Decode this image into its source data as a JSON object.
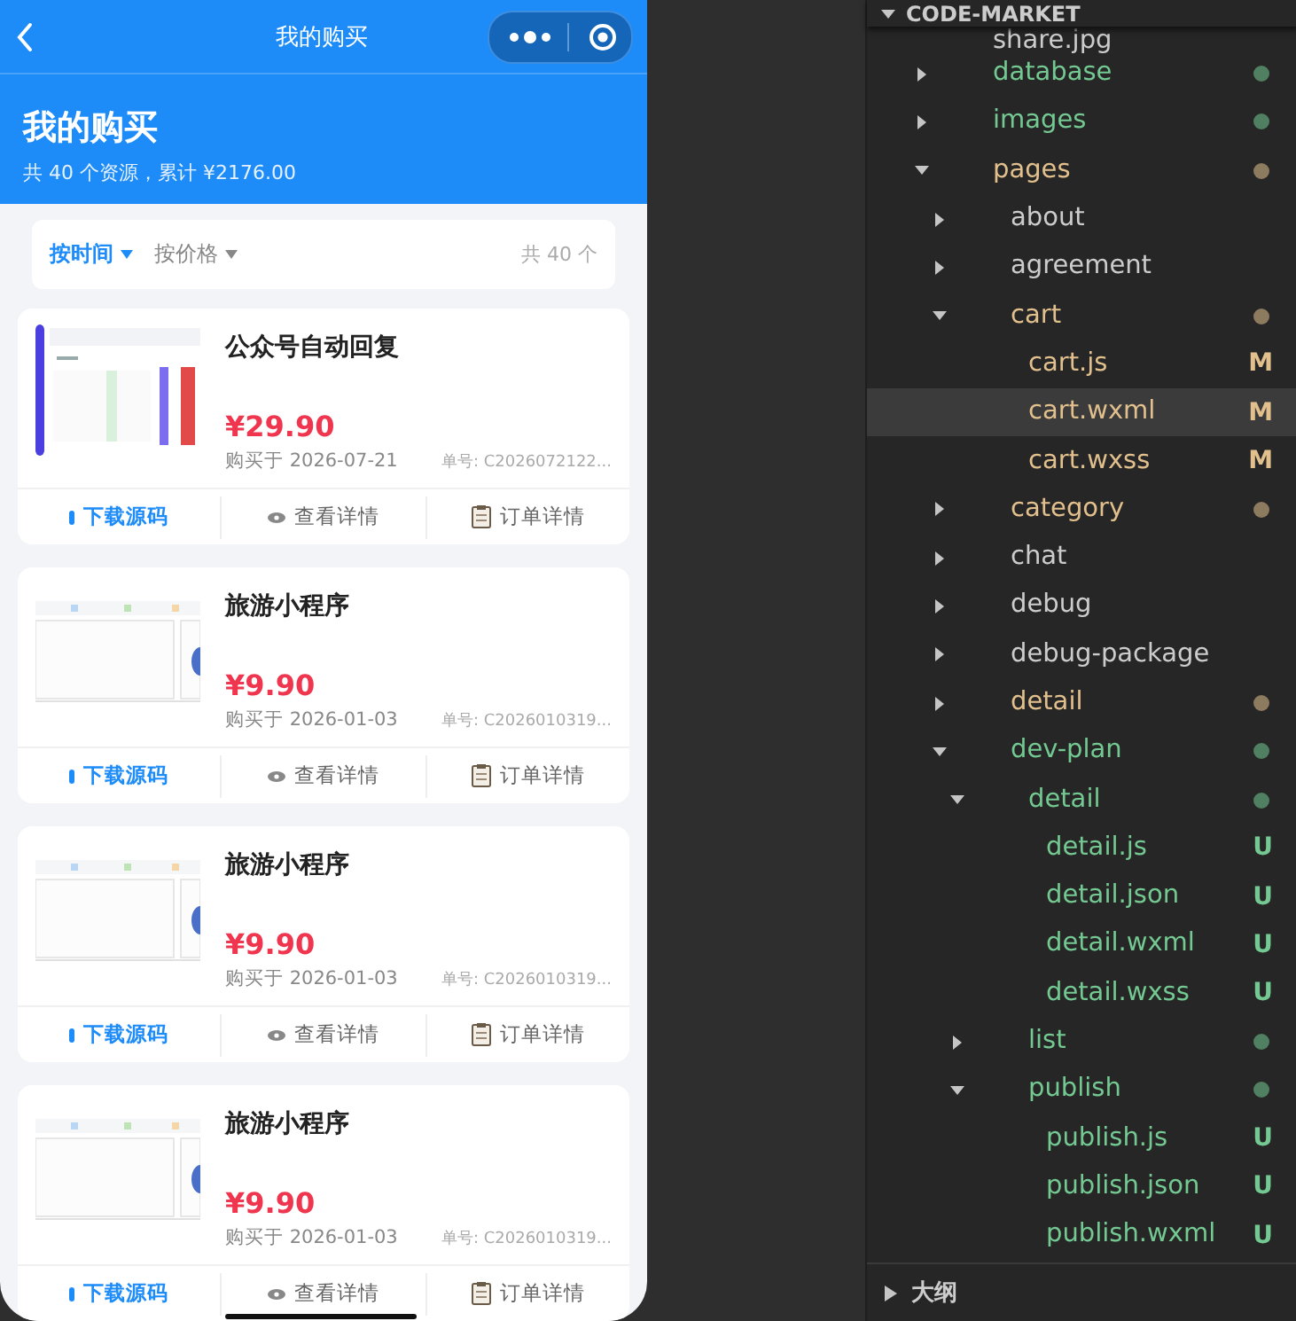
{
  "phone": {
    "nav": {
      "title": "我的购买"
    },
    "header": {
      "title": "我的购买",
      "subtitle": "共 40 个资源，累计 ¥2176.00"
    },
    "sort": [
      {
        "label": "按时间",
        "selected": true
      },
      {
        "label": "按价格",
        "selected": false
      }
    ],
    "count": "共 40 个",
    "orders": [
      {
        "title": "公众号自动回复",
        "price": "¥29.90",
        "date": "购买于 2026-07-21",
        "order_no": "单号: C2026072122...",
        "actions": [
          {
            "kind": "download",
            "label": "下载源码"
          },
          {
            "kind": "view",
            "label": "查看详情"
          },
          {
            "kind": "order",
            "label": "订单详情"
          }
        ]
      },
      {
        "title": "旅游小程序",
        "price": "¥9.90",
        "date": "购买于 2026-01-03",
        "order_no": "单号: C2026010319...",
        "actions": [
          {
            "kind": "download",
            "label": "下载源码"
          },
          {
            "kind": "view",
            "label": "查看详情"
          },
          {
            "kind": "order",
            "label": "订单详情"
          }
        ]
      },
      {
        "title": "旅游小程序",
        "price": "¥9.90",
        "date": "购买于 2026-01-03",
        "order_no": "单号: C2026010319...",
        "actions": [
          {
            "kind": "download",
            "label": "下载源码"
          },
          {
            "kind": "view",
            "label": "查看详情"
          },
          {
            "kind": "order",
            "label": "订单详情"
          }
        ]
      },
      {
        "title": "旅游小程序",
        "price": "¥9.90",
        "date": "购买于 2026-01-03",
        "order_no": "单号: C2026010319...",
        "actions": [
          {
            "kind": "download",
            "label": "下载源码"
          },
          {
            "kind": "view",
            "label": "查看详情"
          },
          {
            "kind": "order",
            "label": "订单详情"
          }
        ]
      }
    ]
  },
  "explorer": {
    "title": "CODE-MARKET",
    "tree": [
      {
        "name": "share.jpg",
        "color": "#cccccc",
        "selected": false
      },
      {
        "name": "database",
        "color": "#73c991",
        "dot": true,
        "expanded": false,
        "selected": false
      },
      {
        "name": "images",
        "color": "#73c991",
        "dot": true,
        "expanded": false,
        "selected": false
      },
      {
        "name": "pages",
        "color": "#e2c08d",
        "dot": true,
        "expanded": true,
        "selected": false,
        "children": [
          {
            "name": "about",
            "color": "#cccccc",
            "expanded": false,
            "selected": false
          },
          {
            "name": "agreement",
            "color": "#cccccc",
            "expanded": false,
            "selected": false
          },
          {
            "name": "cart",
            "color": "#e2c08d",
            "dot": true,
            "expanded": true,
            "selected": false,
            "children": [
              {
                "name": "cart.js",
                "color": "#e2c08d",
                "badge": "M",
                "selected": false
              },
              {
                "name": "cart.wxml",
                "color": "#e2c08d",
                "badge": "M",
                "selected": true
              },
              {
                "name": "cart.wxss",
                "color": "#e2c08d",
                "badge": "M",
                "selected": false
              }
            ]
          },
          {
            "name": "category",
            "color": "#e2c08d",
            "dot": true,
            "expanded": false,
            "selected": false
          },
          {
            "name": "chat",
            "color": "#cccccc",
            "expanded": false,
            "selected": false
          },
          {
            "name": "debug",
            "color": "#cccccc",
            "expanded": false,
            "selected": false
          },
          {
            "name": "debug-package",
            "color": "#cccccc",
            "expanded": false,
            "selected": false
          },
          {
            "name": "detail",
            "color": "#e2c08d",
            "dot": true,
            "expanded": false,
            "selected": false
          },
          {
            "name": "dev-plan",
            "color": "#73c991",
            "dot": true,
            "expanded": true,
            "selected": false,
            "children": [
              {
                "name": "detail",
                "color": "#73c991",
                "dot": true,
                "expanded": true,
                "selected": false,
                "children": [
                  {
                    "name": "detail.js",
                    "color": "#73c991",
                    "badge": "U",
                    "selected": false
                  },
                  {
                    "name": "detail.json",
                    "color": "#73c991",
                    "badge": "U",
                    "selected": false
                  },
                  {
                    "name": "detail.wxml",
                    "color": "#73c991",
                    "badge": "U",
                    "selected": false
                  },
                  {
                    "name": "detail.wxss",
                    "color": "#73c991",
                    "badge": "U",
                    "selected": false
                  }
                ]
              },
              {
                "name": "list",
                "color": "#73c991",
                "dot": true,
                "expanded": false,
                "selected": false
              },
              {
                "name": "publish",
                "color": "#73c991",
                "dot": true,
                "expanded": true,
                "selected": false,
                "children": [
                  {
                    "name": "publish.js",
                    "color": "#73c991",
                    "badge": "U",
                    "selected": false
                  },
                  {
                    "name": "publish.json",
                    "color": "#73c991",
                    "badge": "U",
                    "selected": false
                  },
                  {
                    "name": "publish.wxml",
                    "color": "#73c991",
                    "badge": "U",
                    "selected": false
                  }
                ]
              }
            ]
          }
        ]
      }
    ],
    "outline": {
      "title": "大纲",
      "expanded": false
    }
  }
}
